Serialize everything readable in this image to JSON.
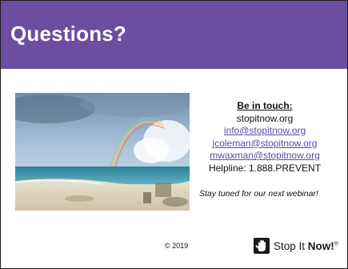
{
  "slide": {
    "title": "Questions?",
    "contact": {
      "heading": "Be in touch:",
      "website": "stopitnow.org",
      "emails": [
        "info@stopitnow.org",
        "jcoleman@stopitnow.org",
        "mwaxman@stopitnow.org"
      ],
      "helpline": "Helpline: 1.888.PREVENT"
    },
    "tagline": "Stay tuned for our next webinar!",
    "copyright": "© 2019",
    "logo": {
      "text_plain": "Stop It ",
      "text_bold": "Now!",
      "trademark": "®",
      "icon": "hand-icon"
    },
    "photo": "beach-rainbow-photo"
  },
  "colors": {
    "title_bar": "#6b4ea0",
    "link": "#5b4ba1"
  }
}
